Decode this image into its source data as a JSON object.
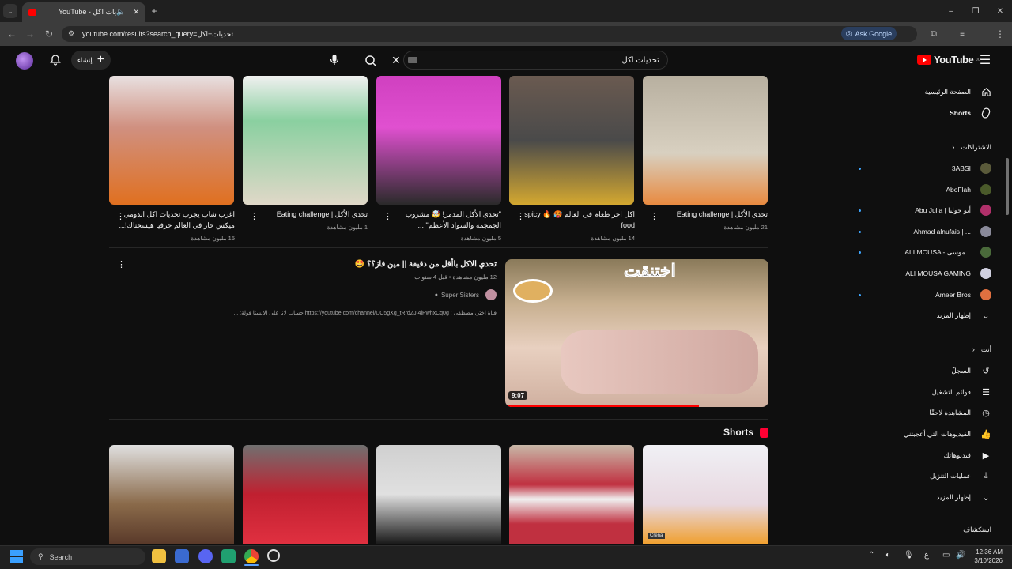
{
  "browser": {
    "tab_title": "YouTube - تحديات اكل",
    "url": "youtube.com/results?search_query=تحديات+اكل",
    "ask_google": "Ask Google",
    "profile_letter": "a"
  },
  "header": {
    "logo": "YouTube",
    "logo_sup": "JO",
    "search_value": "تحديات اكل",
    "create_label": "إنشاء"
  },
  "sidebar": {
    "top_items": [
      {
        "label": "الصفحة الرئيسية",
        "icon": "home-icon"
      },
      {
        "label": "Shorts",
        "icon": "shorts-icon"
      }
    ],
    "subscriptions_title": "الاشتراكات",
    "subscriptions": [
      {
        "label": "3ABSI",
        "avatar_color": "#5a5a3a",
        "dot": true
      },
      {
        "label": "AboFlah",
        "avatar_color": "#4a5a2a",
        "dot": false
      },
      {
        "label": "Abu Julia | أبو جوليا",
        "avatar_color": "#b0306a",
        "dot": true
      },
      {
        "label": "Ahmad alnufais | ...",
        "avatar_color": "#8a8a9a",
        "dot": true
      },
      {
        "label": "ALI MOUSA - موسى...",
        "avatar_color": "#4a6a3a",
        "dot": true
      },
      {
        "label": "ALI MOUSA GAMING",
        "avatar_color": "#d0d0e0",
        "dot": false
      },
      {
        "label": "Ameer Bros",
        "avatar_color": "#e07040",
        "dot": true
      }
    ],
    "show_more": "إظهار المزيد",
    "you_title": "أنت",
    "you_items": [
      {
        "label": "السجلّ",
        "icon": "history-icon"
      },
      {
        "label": "قوائم التشغيل",
        "icon": "playlist-icon"
      },
      {
        "label": "المشاهدة لاحقًا",
        "icon": "clock-icon"
      },
      {
        "label": "الفيديوهات التي أعجبتني",
        "icon": "like-icon"
      },
      {
        "label": "فيديوهاتك",
        "icon": "play-square-icon"
      },
      {
        "label": "عمليات التنزيل",
        "icon": "download-icon"
      },
      {
        "label": "إظهار المزيد",
        "icon": "chevron-down-icon"
      }
    ],
    "explore_title": "استكشاف"
  },
  "shelf_videos": [
    {
      "title": "تحدي الأكل | Eating challenge",
      "meta": "21 مليون مشاهدة",
      "colors": [
        "#c8c0b0",
        "#e88a40"
      ]
    },
    {
      "title": "اكل احر طعام في العالم 🥵 🔥 spicy food",
      "meta": "14 مليون مشاهدة",
      "colors": [
        "#5a5a5a",
        "#d4a830"
      ]
    },
    {
      "title": "\"تحدي الأكل المدمر! 🤯 مشروب الجمجمة والسواد الأعظم\" ...",
      "meta": "5 مليون مشاهدة",
      "colors": [
        "#d040c0",
        "#2a2a2a"
      ]
    },
    {
      "title": "تحدي الأكل | Eating challenge",
      "meta": "1 مليون مشاهدة",
      "colors": [
        "#8ad0a0",
        "#e0d8c8"
      ]
    },
    {
      "title": "اغرب شاب يجرب تحديات اكل اندومي ميكس حار في العالم حرفيا هيسحناك!...",
      "meta": "15 مليون مشاهدة",
      "colors": [
        "#e8e0e0",
        "#e07020"
      ]
    }
  ],
  "featured": {
    "title": "تحدي الاكل باأقل من دقيقة || مين فاز؟؟ 🤩",
    "meta": "12 مليون مشاهدة • قبل 4 سنوات",
    "channel": "Super Sisters",
    "description": "قناة اختي مصطفى : https://youtube.com/channel/UC5gXg_tRrdZJI4iPwhxCq0g حساب لانا على الانستا قولة: ...",
    "duration": "9:07",
    "overlay_text": "اختنقت"
  },
  "shorts": {
    "title": "Shorts",
    "items": [
      {
        "colors": [
          "#e8e8f0",
          "#f0a030"
        ],
        "badge": "Crena"
      },
      {
        "colors": [
          "#c02030",
          "#f0f0f0"
        ],
        "badge": ""
      },
      {
        "colors": [
          "#d0d0d0",
          "#1a1a1a"
        ],
        "badge": ""
      },
      {
        "colors": [
          "#c8b8a8",
          "#c03040"
        ],
        "badge": ""
      },
      {
        "colors": [
          "#8a6a4a",
          "#e0e0e0"
        ],
        "badge": ""
      }
    ]
  },
  "taskbar": {
    "search_label": "Search",
    "time": "12:36 AM",
    "date": "3/10/2026",
    "lang": "ع"
  }
}
